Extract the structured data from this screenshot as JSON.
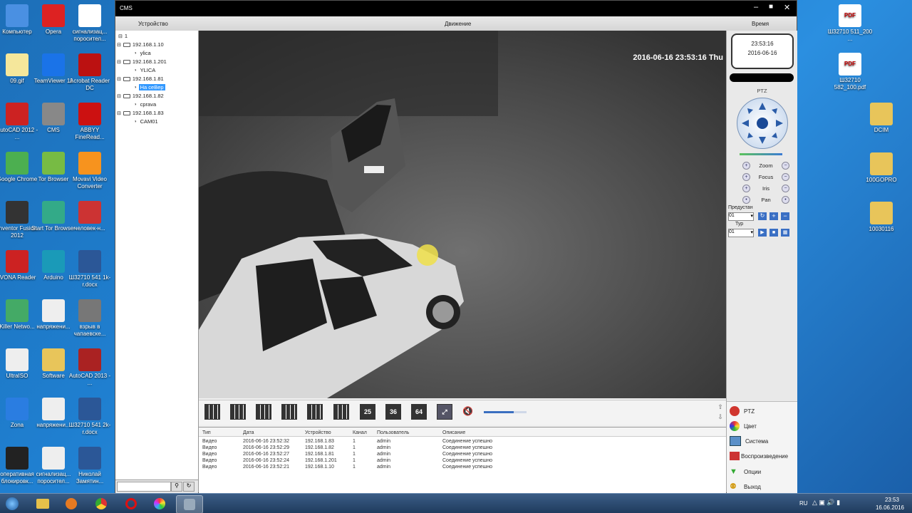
{
  "desktop_icons_left": [
    {
      "label": "Компьютер",
      "name": "computer"
    },
    {
      "label": "Opera",
      "name": "opera"
    },
    {
      "label": "сигнализац... поросител...",
      "name": "doc-signal"
    },
    {
      "label": "09.gif",
      "name": "gif-file"
    },
    {
      "label": "TeamViewer 11",
      "name": "teamviewer"
    },
    {
      "label": "Acrobat Reader DC",
      "name": "acrobat"
    },
    {
      "label": "AutoCAD 2012 - ...",
      "name": "autocad"
    },
    {
      "label": "CMS",
      "name": "cms"
    },
    {
      "label": "ABBYY FineRead...",
      "name": "abbyy"
    },
    {
      "label": "Google Chrome",
      "name": "chrome"
    },
    {
      "label": "Tor Browser",
      "name": "tor"
    },
    {
      "label": "Movavi Video Converter",
      "name": "movavi"
    },
    {
      "label": "Inventor Fusion 2012",
      "name": "inventor"
    },
    {
      "label": "Start Tor Browser",
      "name": "start-tor"
    },
    {
      "label": "человек-н...",
      "name": "chelovek"
    },
    {
      "label": "IVONA Reader",
      "name": "ivona"
    },
    {
      "label": "Arduino",
      "name": "arduino"
    },
    {
      "label": "Ш32710 541 1k-r.docx",
      "name": "word-541"
    },
    {
      "label": "Killer Netwo...",
      "name": "killer"
    },
    {
      "label": "напряжени...",
      "name": "napryazh"
    },
    {
      "label": "взрыв в чапаевске...",
      "name": "vzryv"
    },
    {
      "label": "UltraISO",
      "name": "ultraiso"
    },
    {
      "label": "Software",
      "name": "software"
    },
    {
      "label": "AutoCAD 2013 - ...",
      "name": "autocad2013"
    },
    {
      "label": "Zona",
      "name": "zona"
    },
    {
      "label": "напряжени...",
      "name": "napryazh2"
    },
    {
      "label": "Ш32710 541 2k-r.docx",
      "name": "word-541-2"
    },
    {
      "label": "оперативная блокировк...",
      "name": "operativ"
    },
    {
      "label": "сигнализац... поросител...",
      "name": "signal2"
    },
    {
      "label": "Николай Замятин...",
      "name": "nikolay"
    }
  ],
  "desktop_icons_right": [
    {
      "label": "Ш32710 511_200 ...",
      "name": "pdf-511"
    },
    {
      "label": "Ш32710 582_100.pdf",
      "name": "pdf-582"
    },
    {
      "label": "DCIM",
      "name": "dcim"
    },
    {
      "label": "100GOPRO",
      "name": "gopro"
    },
    {
      "label": "10030116",
      "name": "folder-10030116"
    }
  ],
  "window": {
    "title": "CMS",
    "menu": {
      "device": "Устройство",
      "motion": "Движение",
      "time": "Время"
    }
  },
  "tree": {
    "root": "1",
    "items": [
      {
        "ip": "192.168.1.10",
        "cam": "ylica"
      },
      {
        "ip": "192.168.1.201",
        "cam": "YLICA"
      },
      {
        "ip": "192.168.1.81",
        "cam": "На сеВер"
      },
      {
        "ip": "192.168.1.82",
        "cam": "cprava"
      },
      {
        "ip": "192.168.1.83",
        "cam": "CAM01"
      }
    ],
    "selected": 2
  },
  "video": {
    "overlay": "2016-06-16 23:53:16 Thu"
  },
  "clock": {
    "time": "23:53:16",
    "date": "2016-06-16"
  },
  "ptz": {
    "title": "PTZ",
    "zoom": "Zoom",
    "focus": "Focus",
    "iris": "Iris",
    "pan": "Pan",
    "preset_label": "Предустан",
    "preset_value": "01",
    "tour_label": "Тур",
    "tour_value": "01"
  },
  "layout_buttons": [
    "1",
    "4",
    "6",
    "9",
    "13",
    "16",
    "25",
    "36",
    "64"
  ],
  "volume_percent": 70,
  "log": {
    "headers": {
      "type": "Тип",
      "date": "Дата",
      "device": "Устройство",
      "channel": "Канал",
      "user": "Пользователь",
      "desc": "Описание"
    },
    "rows": [
      {
        "type": "Видео",
        "date": "2016-06-16 23:52:32",
        "device": "192.168.1.83",
        "channel": "1",
        "user": "admin",
        "desc": "Соединение успешно"
      },
      {
        "type": "Видео",
        "date": "2016-06-16 23:52:29",
        "device": "192.168.1.82",
        "channel": "1",
        "user": "admin",
        "desc": "Соединение успешно"
      },
      {
        "type": "Видео",
        "date": "2016-06-16 23:52:27",
        "device": "192.168.1.81",
        "channel": "1",
        "user": "admin",
        "desc": "Соединение успешно"
      },
      {
        "type": "Видео",
        "date": "2016-06-16 23:52:24",
        "device": "192.168.1.201",
        "channel": "1",
        "user": "admin",
        "desc": "Соединение успешно"
      },
      {
        "type": "Видео",
        "date": "2016-06-16 23:52:21",
        "device": "192.168.1.10",
        "channel": "1",
        "user": "admin",
        "desc": "Соединение успешно"
      }
    ]
  },
  "right_menu": {
    "ptz": "PTZ",
    "color": "Цвет",
    "system": "Система",
    "playback": "Воспроизведение",
    "options": "Опции",
    "exit": "Выход"
  },
  "taskbar": {
    "lang": "RU",
    "time": "23:53",
    "date": "16.06.2016"
  }
}
